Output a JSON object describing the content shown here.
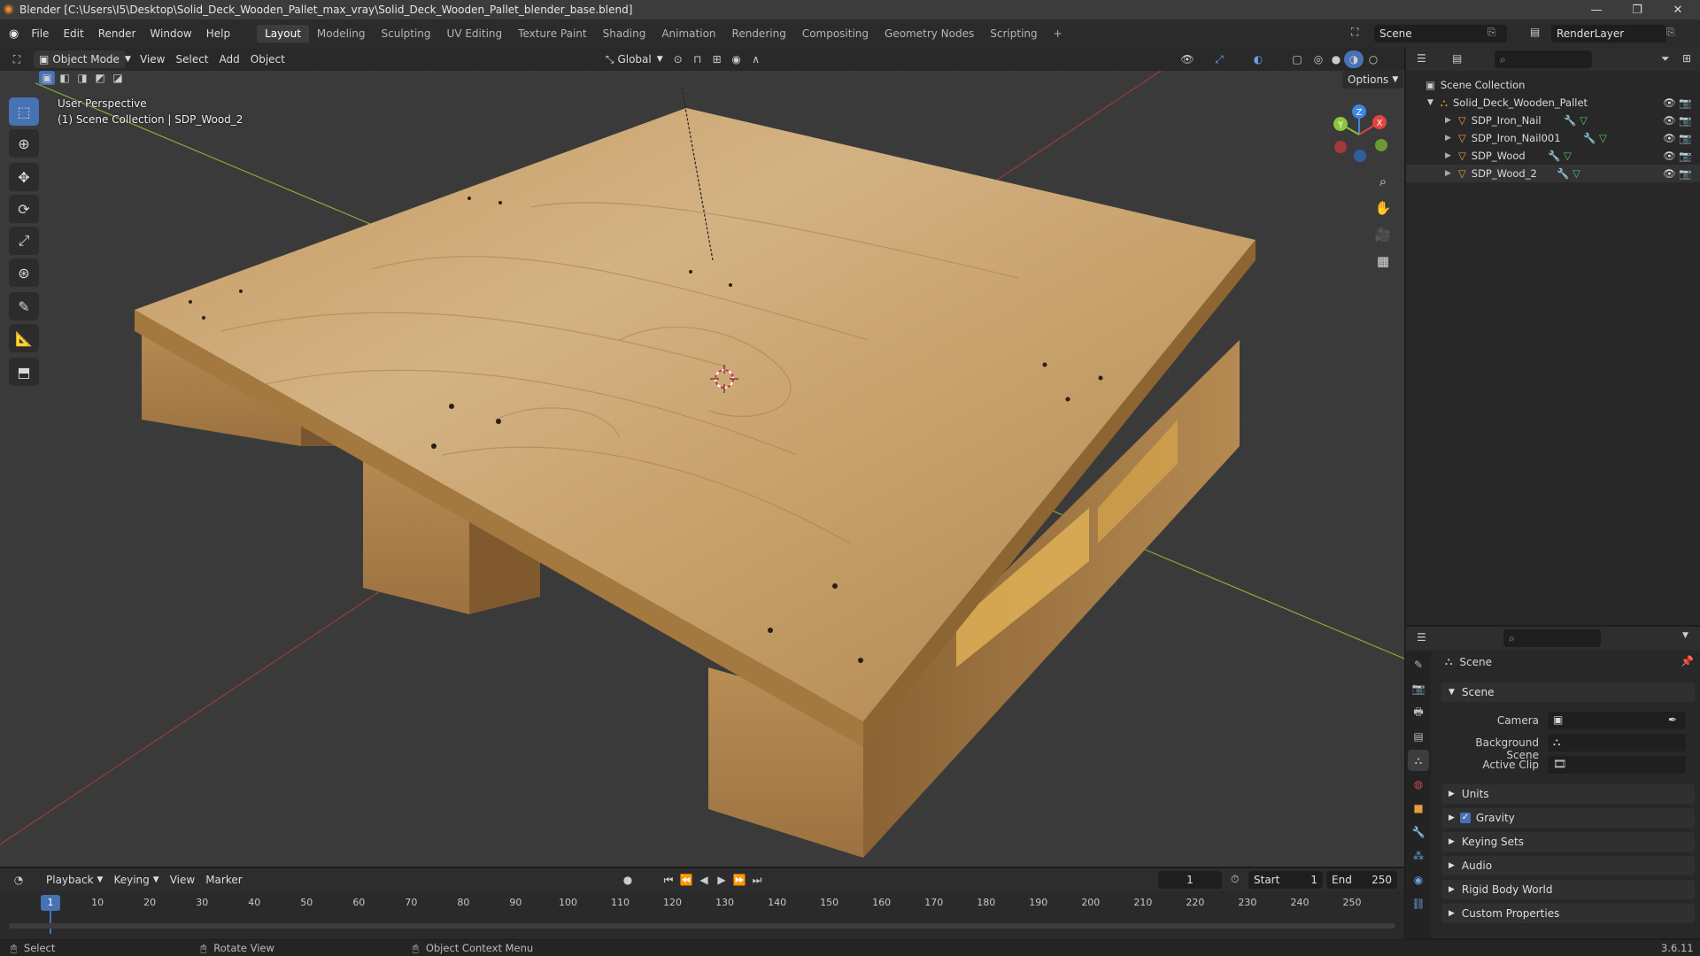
{
  "window": {
    "title": "Blender [C:\\Users\\I5\\Desktop\\Solid_Deck_Wooden_Pallet_max_vray\\Solid_Deck_Wooden_Pallet_blender_base.blend]"
  },
  "menu": [
    "File",
    "Edit",
    "Render",
    "Window",
    "Help"
  ],
  "workspaces": [
    "Layout",
    "Modeling",
    "Sculpting",
    "UV Editing",
    "Texture Paint",
    "Shading",
    "Animation",
    "Rendering",
    "Compositing",
    "Geometry Nodes",
    "Scripting"
  ],
  "active_workspace": "Layout",
  "topbar": {
    "scene": "Scene",
    "view_layer": "RenderLayer"
  },
  "viewport_header": {
    "mode": "Object Mode",
    "menus": [
      "View",
      "Select",
      "Add",
      "Object"
    ],
    "orientation": "Global",
    "options": "Options"
  },
  "viewport": {
    "perspective": "User Perspective",
    "collection_line": "(1) Scene Collection | SDP_Wood_2",
    "gizmo": {
      "z": "Z",
      "y": "Y",
      "x": "X"
    }
  },
  "outliner": {
    "root": "Scene Collection",
    "collection": "Solid_Deck_Wooden_Pallet",
    "objects": [
      "SDP_Iron_Nail",
      "SDP_Iron_Nail001",
      "SDP_Wood",
      "SDP_Wood_2"
    ]
  },
  "properties": {
    "context": "Scene",
    "panel": "Scene",
    "fields": [
      {
        "label": "Camera"
      },
      {
        "label": "Background Scene"
      },
      {
        "label": "Active Clip"
      }
    ],
    "sections": [
      "Units",
      "Gravity",
      "Keying Sets",
      "Audio",
      "Rigid Body World",
      "Custom Properties"
    ],
    "gravity_checked": true
  },
  "timeline": {
    "menus": [
      "Playback",
      "Keying",
      "View",
      "Marker"
    ],
    "current_frame": "1",
    "start_label": "Start",
    "start": "1",
    "end_label": "End",
    "end": "250",
    "ticks": [
      "1",
      "10",
      "20",
      "30",
      "40",
      "50",
      "60",
      "70",
      "80",
      "90",
      "100",
      "110",
      "120",
      "130",
      "140",
      "150",
      "160",
      "170",
      "180",
      "190",
      "200",
      "210",
      "220",
      "230",
      "240",
      "250"
    ]
  },
  "status_bar": {
    "select": "Select",
    "rotate": "Rotate View",
    "context_menu": "Object Context Menu",
    "version": "3.6.11"
  },
  "colors": {
    "accent": "#4772b3",
    "wood": "#c7a06a",
    "object_icon": "#e89b3c",
    "axis_x": "#e0443f",
    "axis_y": "#8cc440",
    "axis_z": "#3f86e0"
  }
}
